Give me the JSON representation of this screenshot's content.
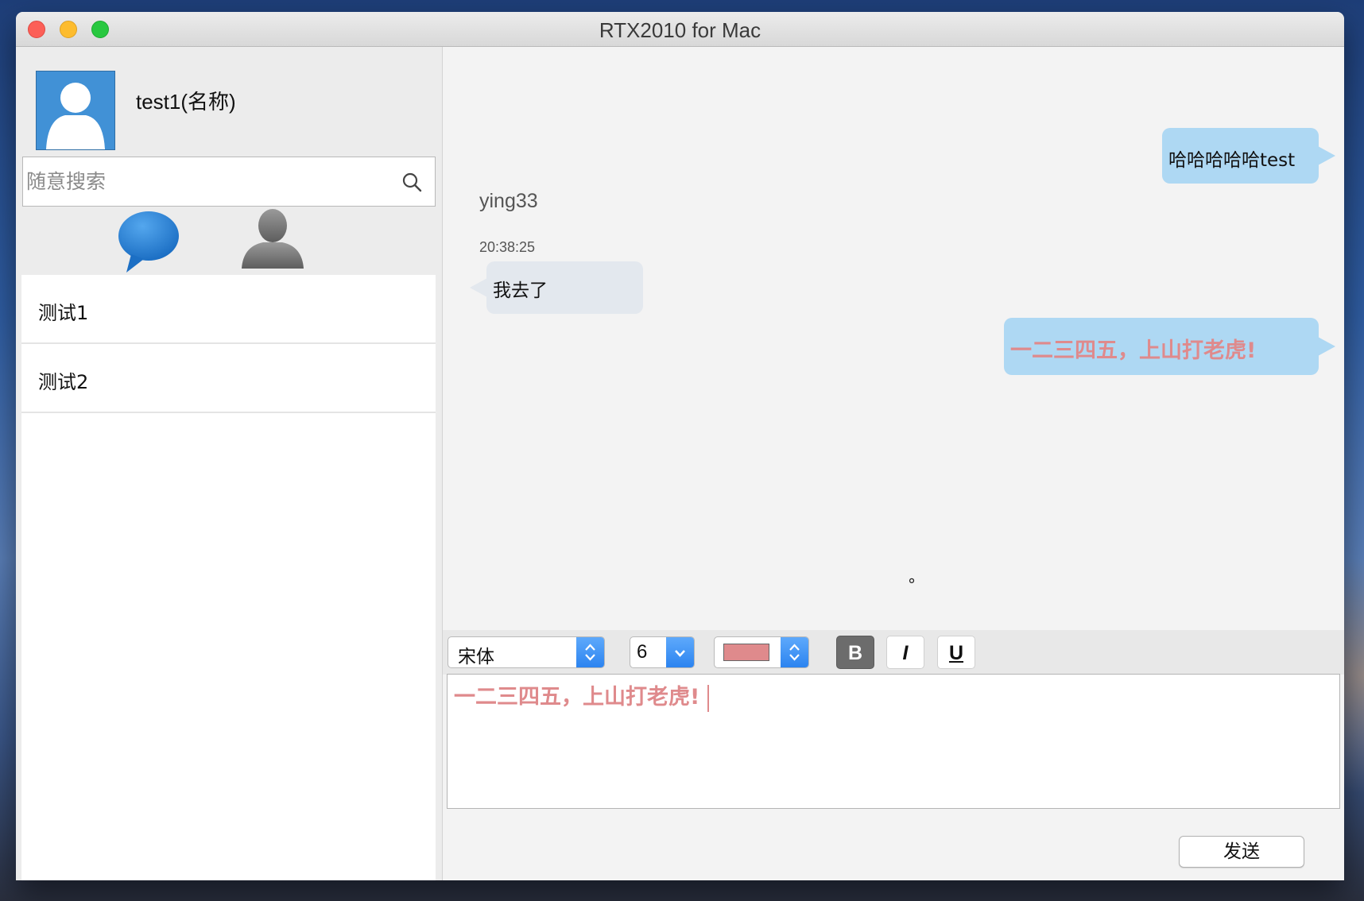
{
  "window": {
    "title": "RTX2010 for Mac"
  },
  "user": {
    "name": "test1(名称)"
  },
  "search": {
    "placeholder": "随意搜索",
    "value": ""
  },
  "contacts": [
    {
      "name": "测试1"
    },
    {
      "name": "测试2"
    }
  ],
  "messages": [
    {
      "direction": "outgoing",
      "text": "哈哈哈哈哈test"
    },
    {
      "direction": "incoming",
      "sender": "ying33",
      "time": "20:38:25",
      "text": "我去了"
    },
    {
      "direction": "outgoing",
      "text": "一二三四五，上山打老虎!"
    }
  ],
  "toolbar": {
    "degree_mark": "°",
    "font": "宋体",
    "size": "6",
    "color": "#df8a8c",
    "bold_label": "B",
    "italic_label": "I",
    "underline_label": "U"
  },
  "compose": {
    "text": "一二三四五，上山打老虎!"
  },
  "send_label": "发送",
  "colors": {
    "accent": "#2c84f0",
    "outgoing_bubble": "#aed8f3",
    "incoming_bubble": "#e3e8ee",
    "text_color": "#df8a8c"
  },
  "icons": [
    "close-light-icon",
    "minimize-light-icon",
    "maximize-light-icon",
    "avatar-icon",
    "search-icon",
    "chat-bubble-icon",
    "contacts-icon",
    "stepper-icon",
    "dropdown-chevron-icon"
  ]
}
